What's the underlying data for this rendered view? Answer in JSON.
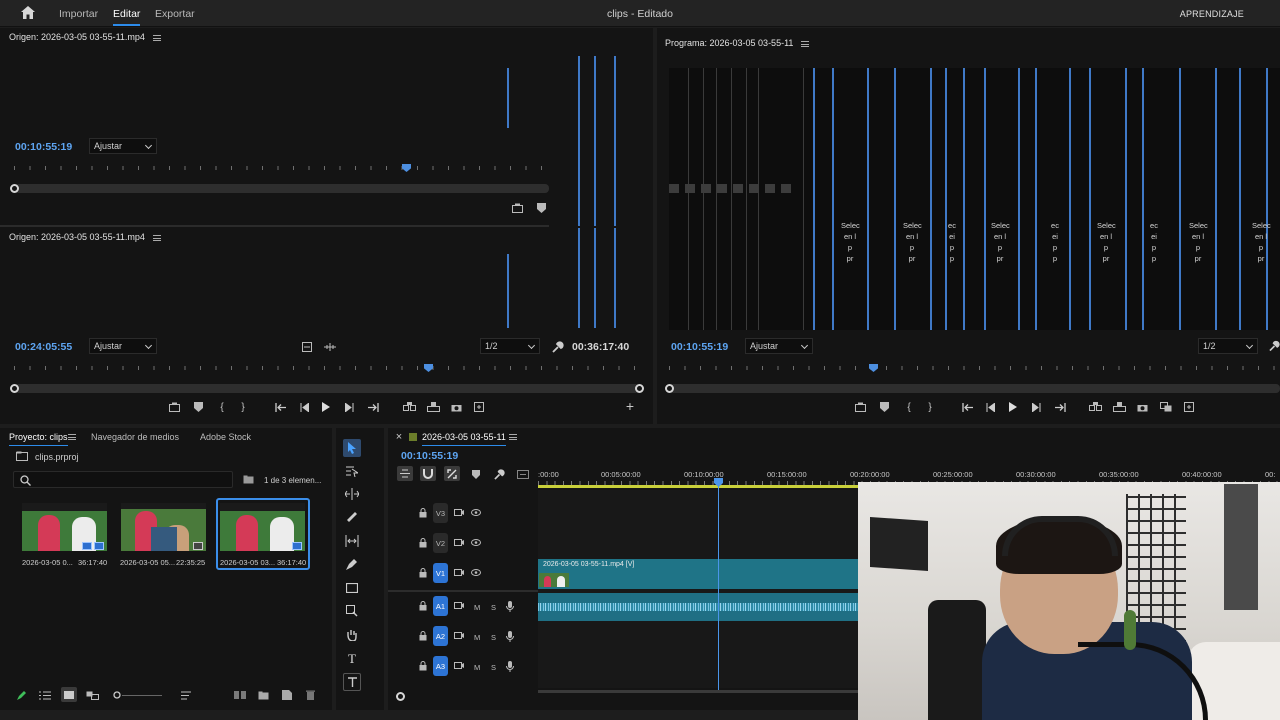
{
  "topbar": {
    "nav": [
      "Importar",
      "Editar",
      "Exportar"
    ],
    "title": "clips - Editado",
    "learn": "APRENDIZAJE"
  },
  "source_top": {
    "header": "Origen: 2026-03-05 03-55-11.mp4",
    "timecode": "00:10:55:19",
    "fit": "Ajustar"
  },
  "source_bottom": {
    "header": "Origen: 2026-03-05 03-55-11.mp4",
    "timecode": "00:24:05:55",
    "fit": "Ajustar",
    "resolution": "1/2",
    "duration": "00:36:17:40"
  },
  "program": {
    "header": "Programa: 2026-03-05 03-55-11",
    "timecode": "00:10:55:19",
    "fit": "Ajustar",
    "resolution": "1/2",
    "snippet_lines": [
      "Selec",
      "en l",
      "p",
      "pr"
    ],
    "snippet_lines_b": [
      "ec",
      "ei",
      "p",
      "p"
    ]
  },
  "project": {
    "tabs": [
      "Proyecto: clips",
      "Navegador de medios",
      "Adobe Stock"
    ],
    "file": "clips.prproj",
    "count": "1 de 3 elemen...",
    "items": [
      {
        "name": "2026-03-05 0...",
        "duration": "36:17:40"
      },
      {
        "name": "2026-03-05 05...",
        "duration": "22:35:25"
      },
      {
        "name": "2026-03-05 03...",
        "duration": "36:17:40"
      }
    ]
  },
  "timeline": {
    "tab": "2026-03-05 03-55-11",
    "timecode": "00:10:55:19",
    "ruler": [
      ":00:00",
      "00:05:00:00",
      "00:10:00:00",
      "00:15:00:00",
      "00:20:00:00",
      "00:25:00:00",
      "00:30:00:00",
      "00:35:00:00",
      "00:40:00:00",
      "00:"
    ],
    "video_tracks": [
      "V3",
      "V2",
      "V1"
    ],
    "audio_tracks": [
      "A1",
      "A2",
      "A3"
    ],
    "mute": "M",
    "solo": "S",
    "clip_label": "2026-03-05 03-55-11.mp4 [V]"
  },
  "colors": {
    "accent": "#2d8ceb",
    "timecode": "#5ea5f2",
    "clip": "#1f7487"
  }
}
